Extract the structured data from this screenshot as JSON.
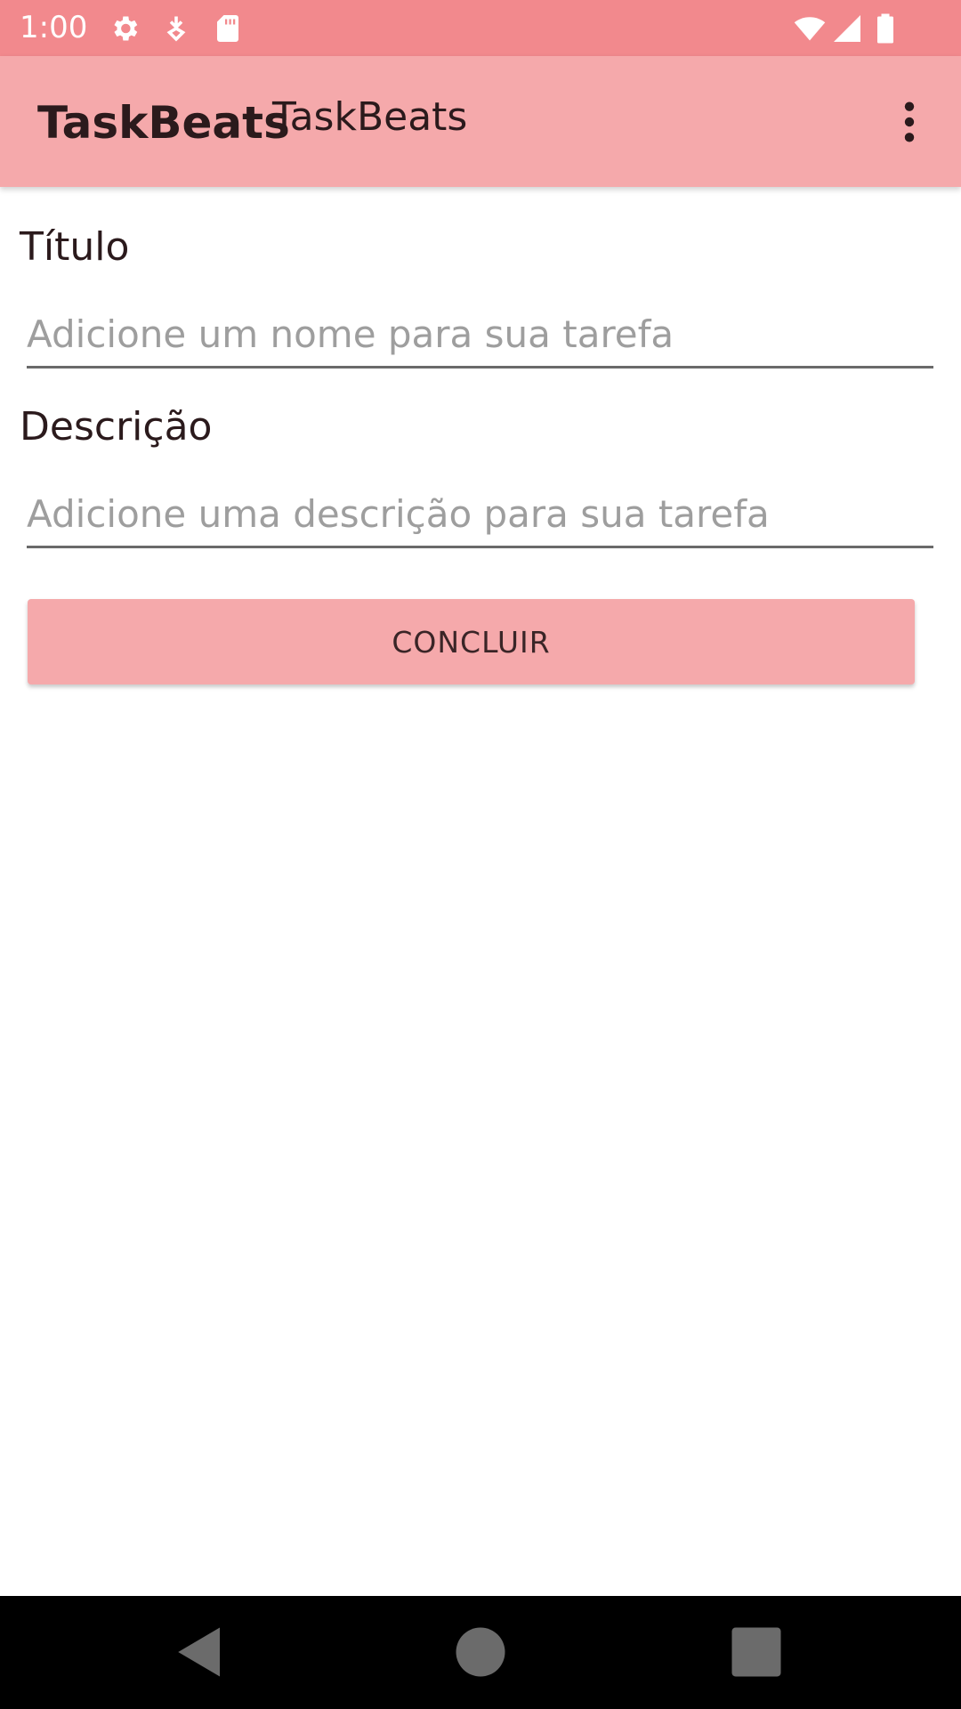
{
  "status_bar": {
    "time": "1:00",
    "icons": [
      "settings-icon",
      "download-icon",
      "sd-card-icon",
      "wifi-icon",
      "cell-signal-icon",
      "battery-icon"
    ]
  },
  "app_bar": {
    "title": "TaskBeats",
    "subtitle": "TaskBeats",
    "menu_icon": "more-vert-icon"
  },
  "form": {
    "title_label": "Título",
    "title_placeholder": "Adicione um nome para sua tarefa",
    "title_value": "",
    "description_label": "Descrição",
    "description_placeholder": "Adicione uma descrição para sua tarefa",
    "description_value": "",
    "submit_label": "CONCLUIR"
  },
  "nav_bar": {
    "icons": [
      "back-icon",
      "home-icon",
      "recents-icon"
    ]
  },
  "colors": {
    "status_bar": "#f2898d",
    "app_bar": "#f5a9ab",
    "button": "#f5a9ab",
    "text": "#2b1a1c",
    "nav_bar": "#000000"
  }
}
